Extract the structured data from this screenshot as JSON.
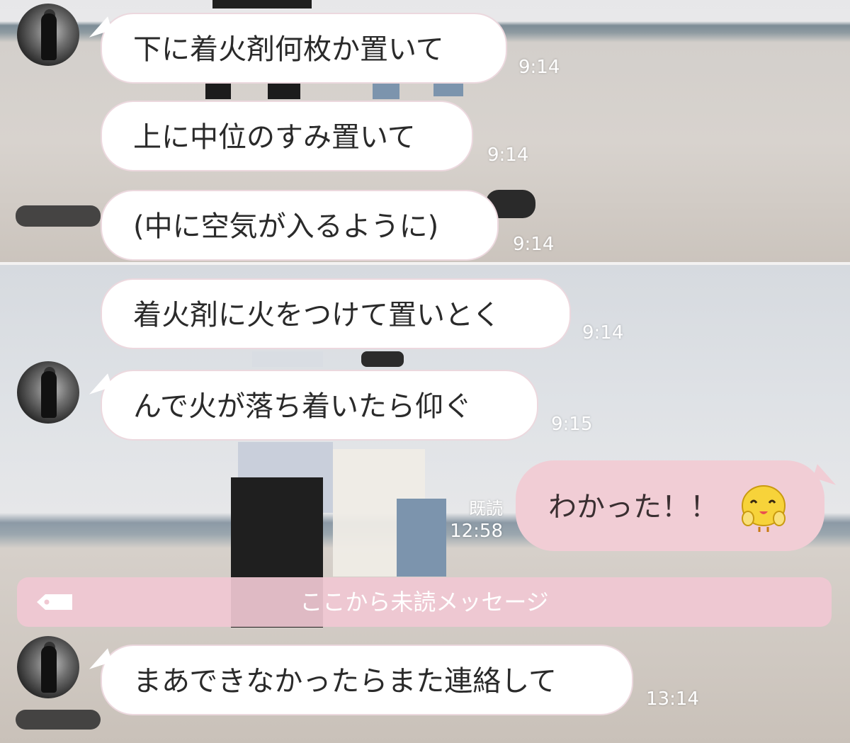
{
  "messages": [
    {
      "text": "下に着火剤何枚か置いて",
      "time": "9:14"
    },
    {
      "text": "上に中位のすみ置いて",
      "time": "9:14"
    },
    {
      "text": "(中に空気が入るように)",
      "time": "9:14"
    },
    {
      "text": "着火剤に火をつけて置いとく",
      "time": "9:14"
    },
    {
      "text": "んで火が落ち着いたら仰ぐ",
      "time": "9:15"
    },
    {
      "text": "まあできなかったらまた連絡して",
      "time": "13:14"
    }
  ],
  "my_message": {
    "text": "わかった！！",
    "read_label": "既読",
    "time": "12:58",
    "sticker": "chick-peace-sticker"
  },
  "unread_divider": {
    "label": "ここから未読メッセージ",
    "icon": "tag-icon"
  },
  "colors": {
    "my_bubble": "#f1cdd5",
    "their_bubble": "#ffffff",
    "unread_bar": "#f0c8d2"
  }
}
